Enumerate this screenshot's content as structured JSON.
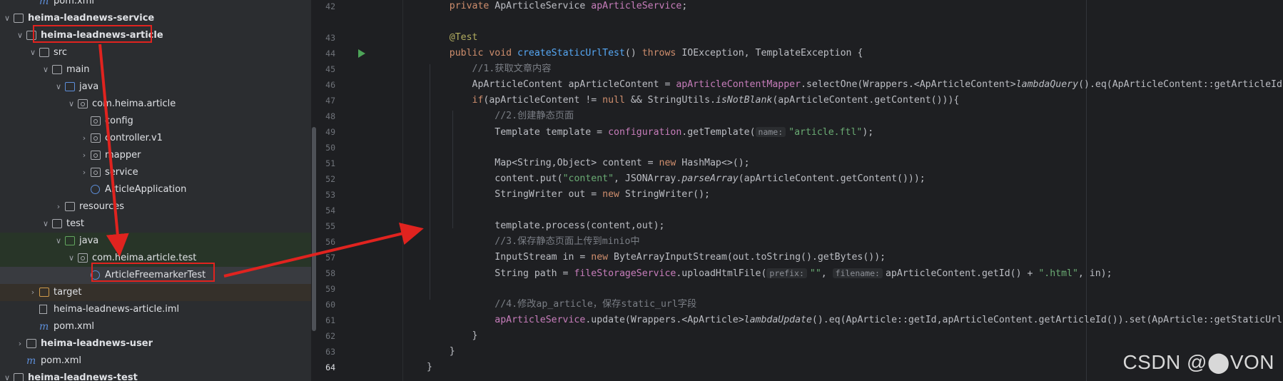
{
  "tree": {
    "rows": [
      {
        "label": "pom.xml",
        "depth": 2,
        "chev": "",
        "icon": "m",
        "bold": false
      },
      {
        "label": "heima-leadnews-service",
        "depth": 0,
        "chev": "v",
        "icon": "module",
        "bold": true
      },
      {
        "label": "heima-leadnews-article",
        "depth": 1,
        "chev": "v",
        "icon": "module",
        "bold": true
      },
      {
        "label": "src",
        "depth": 2,
        "chev": "v",
        "icon": "folder",
        "bold": false
      },
      {
        "label": "main",
        "depth": 3,
        "chev": "v",
        "icon": "folder",
        "bold": false
      },
      {
        "label": "java",
        "depth": 4,
        "chev": "v",
        "icon": "blue",
        "bold": false
      },
      {
        "label": "com.heima.article",
        "depth": 5,
        "chev": "v",
        "icon": "pkg",
        "bold": false
      },
      {
        "label": "config",
        "depth": 6,
        "chev": "",
        "icon": "pkg",
        "bold": false
      },
      {
        "label": "controller.v1",
        "depth": 6,
        "chev": ">",
        "icon": "pkg",
        "bold": false
      },
      {
        "label": "mapper",
        "depth": 6,
        "chev": ">",
        "icon": "pkg",
        "bold": false
      },
      {
        "label": "service",
        "depth": 6,
        "chev": ">",
        "icon": "pkg",
        "bold": false
      },
      {
        "label": "ArticleApplication",
        "depth": 6,
        "chev": "",
        "icon": "class",
        "bold": false
      },
      {
        "label": "resources",
        "depth": 4,
        "chev": ">",
        "icon": "folder",
        "bold": false
      },
      {
        "label": "test",
        "depth": 3,
        "chev": "v",
        "icon": "folder",
        "bold": false
      },
      {
        "label": "java",
        "depth": 4,
        "chev": "v",
        "icon": "green",
        "bold": false
      },
      {
        "label": "com.heima.article.test",
        "depth": 5,
        "chev": "v",
        "icon": "pkg",
        "bold": false
      },
      {
        "label": "ArticleFreemarkerTest",
        "depth": 6,
        "chev": "",
        "icon": "class",
        "bold": false
      },
      {
        "label": "target",
        "depth": 2,
        "chev": ">",
        "icon": "orange",
        "bold": false
      },
      {
        "label": "heima-leadnews-article.iml",
        "depth": 2,
        "chev": "",
        "icon": "iml",
        "bold": false
      },
      {
        "label": "pom.xml",
        "depth": 2,
        "chev": "",
        "icon": "m",
        "bold": false
      },
      {
        "label": "heima-leadnews-user",
        "depth": 1,
        "chev": ">",
        "icon": "module",
        "bold": true
      },
      {
        "label": "pom.xml",
        "depth": 1,
        "chev": "",
        "icon": "m",
        "bold": false
      },
      {
        "label": "heima-leadnews-test",
        "depth": 0,
        "chev": "v",
        "icon": "module",
        "bold": true
      }
    ]
  },
  "editor": {
    "line_numbers": [
      "42",
      "",
      "43",
      "44",
      "45",
      "46",
      "47",
      "48",
      "49",
      "50",
      "51",
      "52",
      "53",
      "54",
      "55",
      "56",
      "57",
      "58",
      "59",
      "60",
      "61",
      "62",
      "63",
      "64"
    ],
    "lines": [
      [
        {
          "t": "    private ",
          "c": "kw"
        },
        {
          "t": "ApArticleService ",
          "c": "plain"
        },
        {
          "t": "apArticleService",
          "c": "fld"
        },
        {
          "t": ";",
          "c": "plain"
        }
      ],
      [],
      [
        {
          "t": "    ",
          "c": "plain"
        },
        {
          "t": "@Test",
          "c": "ann"
        }
      ],
      [
        {
          "t": "    public void ",
          "c": "kw"
        },
        {
          "t": "createStaticUrlTest",
          "c": "fn"
        },
        {
          "t": "() ",
          "c": "plain"
        },
        {
          "t": "throws ",
          "c": "kw"
        },
        {
          "t": "IOException, TemplateException {",
          "c": "plain"
        }
      ],
      [
        {
          "t": "        //1.获取文章内容",
          "c": "cm"
        }
      ],
      [
        {
          "t": "        ApArticleContent apArticleContent = ",
          "c": "plain"
        },
        {
          "t": "apArticleContentMapper",
          "c": "fld"
        },
        {
          "t": ".selectOne(Wrappers.<ApArticleContent>",
          "c": "plain"
        },
        {
          "t": "lambdaQuery",
          "c": "it"
        },
        {
          "t": "().eq(ApArticleContent::getArticleId, ",
          "c": "plain"
        }
      ],
      [
        {
          "t": "        ",
          "c": "plain"
        },
        {
          "t": "if",
          "c": "kw"
        },
        {
          "t": "(apArticleContent != ",
          "c": "plain"
        },
        {
          "t": "null ",
          "c": "kw"
        },
        {
          "t": "&& StringUtils.",
          "c": "plain"
        },
        {
          "t": "isNotBlank",
          "c": "it"
        },
        {
          "t": "(apArticleContent.getContent())){",
          "c": "plain"
        }
      ],
      [
        {
          "t": "            //2.创建静态页面",
          "c": "cm"
        }
      ],
      [
        {
          "t": "            Template template = ",
          "c": "plain"
        },
        {
          "t": "configuration",
          "c": "fld"
        },
        {
          "t": ".getTemplate(",
          "c": "plain"
        },
        {
          "t": "name:",
          "c": "hint"
        },
        {
          "t": "\"article.ftl\"",
          "c": "str"
        },
        {
          "t": ");",
          "c": "plain"
        }
      ],
      [],
      [
        {
          "t": "            Map<String,Object> content = ",
          "c": "plain"
        },
        {
          "t": "new ",
          "c": "kw"
        },
        {
          "t": "HashMap<>();",
          "c": "plain"
        }
      ],
      [
        {
          "t": "            content.put(",
          "c": "plain"
        },
        {
          "t": "\"content\"",
          "c": "str"
        },
        {
          "t": ", JSONArray.",
          "c": "plain"
        },
        {
          "t": "parseArray",
          "c": "it"
        },
        {
          "t": "(apArticleContent.getContent()));",
          "c": "plain"
        }
      ],
      [
        {
          "t": "            StringWriter out = ",
          "c": "plain"
        },
        {
          "t": "new ",
          "c": "kw"
        },
        {
          "t": "StringWriter();",
          "c": "plain"
        }
      ],
      [],
      [
        {
          "t": "            template.process(content,out);",
          "c": "plain"
        }
      ],
      [
        {
          "t": "            //3.保存静态页面上传到minio中",
          "c": "cm"
        }
      ],
      [
        {
          "t": "            InputStream in = ",
          "c": "plain"
        },
        {
          "t": "new ",
          "c": "kw"
        },
        {
          "t": "ByteArrayInputStream(out.toString().getBytes());",
          "c": "plain"
        }
      ],
      [
        {
          "t": "            String path = ",
          "c": "plain"
        },
        {
          "t": "fileStorageService",
          "c": "fld"
        },
        {
          "t": ".uploadHtmlFile(",
          "c": "plain"
        },
        {
          "t": "prefix:",
          "c": "hint"
        },
        {
          "t": "\"\"",
          "c": "str"
        },
        {
          "t": ", ",
          "c": "plain"
        },
        {
          "t": "filename:",
          "c": "hint"
        },
        {
          "t": "apArticleContent.getId() + ",
          "c": "plain"
        },
        {
          "t": "\".html\"",
          "c": "str"
        },
        {
          "t": ", in);",
          "c": "plain"
        }
      ],
      [],
      [
        {
          "t": "            //4.修改ap_article，保存static_url字段",
          "c": "cm"
        }
      ],
      [
        {
          "t": "            ",
          "c": "plain"
        },
        {
          "t": "apArticleService",
          "c": "fld"
        },
        {
          "t": ".update(Wrappers.<ApArticle>",
          "c": "plain"
        },
        {
          "t": "lambdaUpdate",
          "c": "it"
        },
        {
          "t": "().eq(ApArticle::getId,apArticleContent.getArticleId()).set(ApArticle::getStaticUrl,pa",
          "c": "plain"
        }
      ],
      [
        {
          "t": "        }",
          "c": "plain"
        }
      ],
      [
        {
          "t": "    }",
          "c": "plain"
        }
      ],
      [
        {
          "t": "}",
          "c": "plain"
        }
      ]
    ],
    "run_icon_line": "44",
    "active_line": "64"
  },
  "watermark": "CSDN @⬤VON",
  "annotations": {
    "color": "#e0231f"
  }
}
